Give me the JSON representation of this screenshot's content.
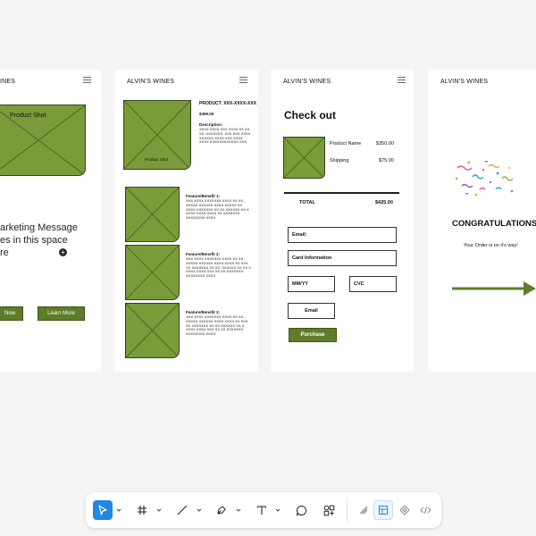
{
  "frame1": {
    "header": "INES",
    "placeholder_label": "Product Shot",
    "marketing_lines": [
      "arketing Message",
      "es in this space",
      "re"
    ],
    "plus_icon": "plus-circle-icon",
    "buttons": [
      "Now",
      "Learn More"
    ]
  },
  "frame2": {
    "header": "ALVIN'S WINES",
    "product_code": "PRODUCT: XXX-XXXX-XXX",
    "price": "$399.00",
    "description_label": "Description:",
    "description_text": "XXXX XXXX XXX XXXX XX XX XX. XXXXXXX. XXX XXX XXXX XXXXXX XXXX XXX XXXX XXXX XXXXXXXXXXXX XXX.",
    "main_placeholder_label": "Product Shot",
    "features": [
      {
        "title": "Feature/Benefit 1:",
        "text": "XXX XXXX XXXXXXX XXXX XX XX - XXXXX XXXXXX XXXX XXXXX XX XXXX XXXXXXX XX XX XXXXXX XX X XXXX XXXX XXXX XX XXXXXXX XXXXXXXX XXXX"
      },
      {
        "title": "Feature/Benefit 2:",
        "text": "XXX XXXX XXXXXXX XXXX XX XX - XXXXX XXXXXX XXXX XXXX XX XXX XX XXXXXXX XX XX. XXXXXX XX XX X XXXX XXXX XXX XX XX XXXXXXX XXXXXXXX XXXX"
      },
      {
        "title": "Feature/Benefit 3:",
        "text": "XXX XXXX XXXXXXX XXXX XX XX - XXXXX XXXXXX XXXX XXXX XX XXX XX XXXXXXX XX XX XXXXXX XX X XXXX XXXX XXX XX XX XXXXXXX XXXXXXXX XXXX"
      }
    ]
  },
  "frame3": {
    "header": "ALVIN'S WINES",
    "title": "Check out",
    "product_name_label": "Product Name",
    "product_price": "$350.00",
    "shipping_label": "Shipping",
    "shipping_price": "$75.00",
    "total_label": "TOTAL",
    "total_value": "$425.00",
    "email_field": "Email:",
    "card_field": "Card Information",
    "mmyy_field": "MM/YY",
    "cvc_field": "CVC",
    "email_button": "Email",
    "purchase_button": "Purchase"
  },
  "frame4": {
    "header": "ALVIN'S WINES",
    "congrats": "CONGRATULATIONS",
    "order_message": "Your Order is on it's way!",
    "confetti_icon": "confetti-icon",
    "arrow_icon": "arrow-right-icon"
  },
  "toolbar": {
    "tools": [
      "select-pointer-icon",
      "frame-grid-icon",
      "line-icon",
      "pen-icon",
      "text-icon",
      "comment-icon",
      "shapes-components-icon",
      "pencil-draw-icon",
      "design-inspect-icon",
      "prototype-icon",
      "code-icon"
    ]
  },
  "colors": {
    "accent_green": "#7a9b3a",
    "button_green": "#5e7d2a",
    "select_blue": "#1e88e5"
  }
}
